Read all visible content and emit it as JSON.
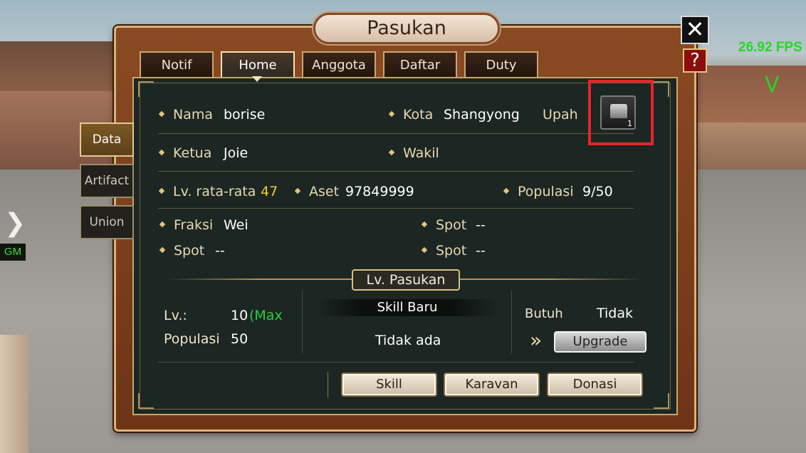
{
  "overlay": {
    "fps": "26.92 FPS",
    "gm_label": "GM",
    "v_glyph": "V"
  },
  "window": {
    "title": "Pasukan",
    "close_glyph": "✕",
    "help_glyph": "?"
  },
  "tabs": [
    {
      "label": "Notif"
    },
    {
      "label": "Home",
      "active": true
    },
    {
      "label": "Anggota"
    },
    {
      "label": "Daftar"
    },
    {
      "label": "Duty"
    }
  ],
  "side_tabs": [
    {
      "label": "Data",
      "active": true
    },
    {
      "label": "Artifact"
    },
    {
      "label": "Union"
    }
  ],
  "info": {
    "nama": {
      "label": "Nama",
      "value": "borise"
    },
    "kota": {
      "label": "Kota",
      "value": "Shangyong"
    },
    "upah": {
      "label": "Upah",
      "chest_count": "1"
    },
    "ketua": {
      "label": "Ketua",
      "value": "Joie"
    },
    "wakil": {
      "label": "Wakil",
      "value": ""
    },
    "lv_rata": {
      "label": "Lv. rata-rata",
      "value": "47"
    },
    "aset": {
      "label": "Aset",
      "value": "97849999"
    },
    "populasi": {
      "label": "Populasi",
      "value": "9/50"
    },
    "fraksi": {
      "label": "Fraksi",
      "value": "Wei"
    },
    "spot_1": {
      "label": "Spot",
      "value": "--"
    },
    "spot_2": {
      "label": "Spot",
      "value": "--"
    },
    "spot_3": {
      "label": "Spot",
      "value": "--"
    }
  },
  "level_section": {
    "title": "Lv. Pasukan",
    "lv_label": "Lv.:",
    "lv_value": "10",
    "lv_max": "(Max",
    "pop_label": "Populasi",
    "pop_value": "50",
    "skill_title": "Skill Baru",
    "skill_value": "Tidak ada",
    "butuh_label": "Butuh",
    "butuh_value": "Tidak",
    "upgrade_label": "Upgrade"
  },
  "buttons": {
    "skill": "Skill",
    "karavan": "Karavan",
    "donasi": "Donasi"
  },
  "colors": {
    "accent_gold": "#e1c47e",
    "highlight_red": "#e8242a",
    "fps_green": "#1fdc1f",
    "max_green": "#2ecc40",
    "level_yellow": "#f2cd32"
  }
}
